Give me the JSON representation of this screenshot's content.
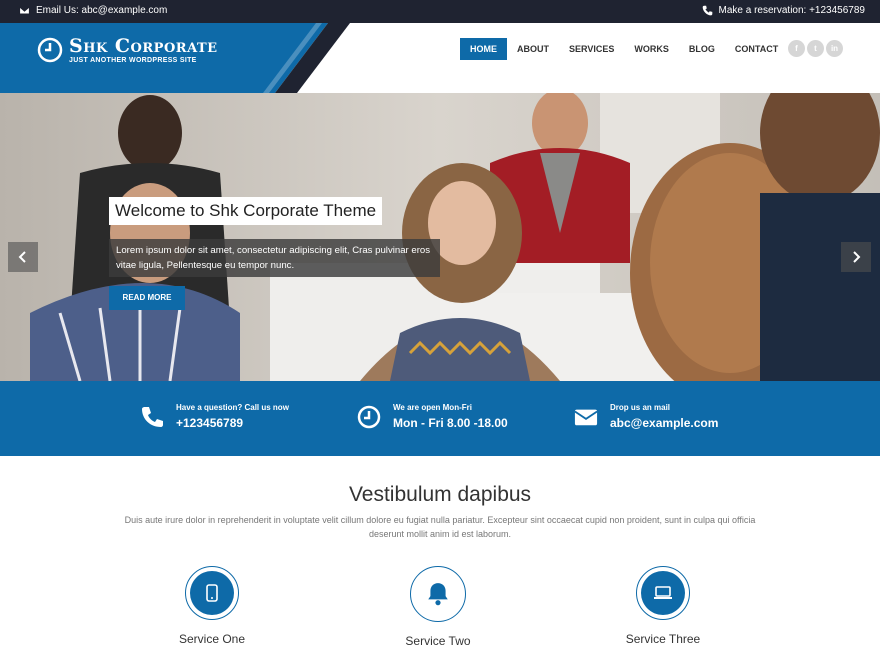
{
  "topbar": {
    "email_text": "Email Us: abc@example.com",
    "reservation_text": "Make a reservation: +123456789"
  },
  "brand": {
    "title": "Shk Corporate",
    "tagline": "JUST ANOTHER WORDPRESS SITE"
  },
  "nav": {
    "items": [
      {
        "label": "HOME",
        "active": true
      },
      {
        "label": "ABOUT"
      },
      {
        "label": "SERVICES"
      },
      {
        "label": "WORKS"
      },
      {
        "label": "BLOG"
      },
      {
        "label": "CONTACT"
      }
    ]
  },
  "social": {
    "facebook": "f",
    "twitter": "t",
    "linkedin": "in"
  },
  "hero": {
    "caption_title": "Welcome to Shk Corporate Theme",
    "caption_text": "Lorem ipsum dolor sit amet, consectetur adipiscing elit, Cras pulvinar eros vitae ligula, Pellentesque eu tempor nunc.",
    "button_label": "READ MORE"
  },
  "infobar": {
    "items": [
      {
        "small": "Have a question? Call us now",
        "big": "+123456789",
        "icon": "phone-icon"
      },
      {
        "small": "We are open Mon-Fri",
        "big": "Mon - Fri 8.00 -18.00",
        "icon": "clock-icon"
      },
      {
        "small": "Drop us an mail",
        "big": "abc@example.com",
        "icon": "envelope-icon"
      }
    ]
  },
  "intro": {
    "title": "Vestibulum dapibus",
    "text": "Duis aute irure dolor in reprehenderit in voluptate velit cillum dolore eu fugiat nulla pariatur. Excepteur sint occaecat cupid non proident, sunt in culpa qui officia deserunt mollit anim id est laborum."
  },
  "services": [
    {
      "label": "Service One",
      "icon": "mobile-icon"
    },
    {
      "label": "Service Two",
      "icon": "bell-icon"
    },
    {
      "label": "Service Three",
      "icon": "laptop-icon"
    }
  ],
  "colors": {
    "accent": "#0e6aa8",
    "topbar": "#1f2331"
  }
}
